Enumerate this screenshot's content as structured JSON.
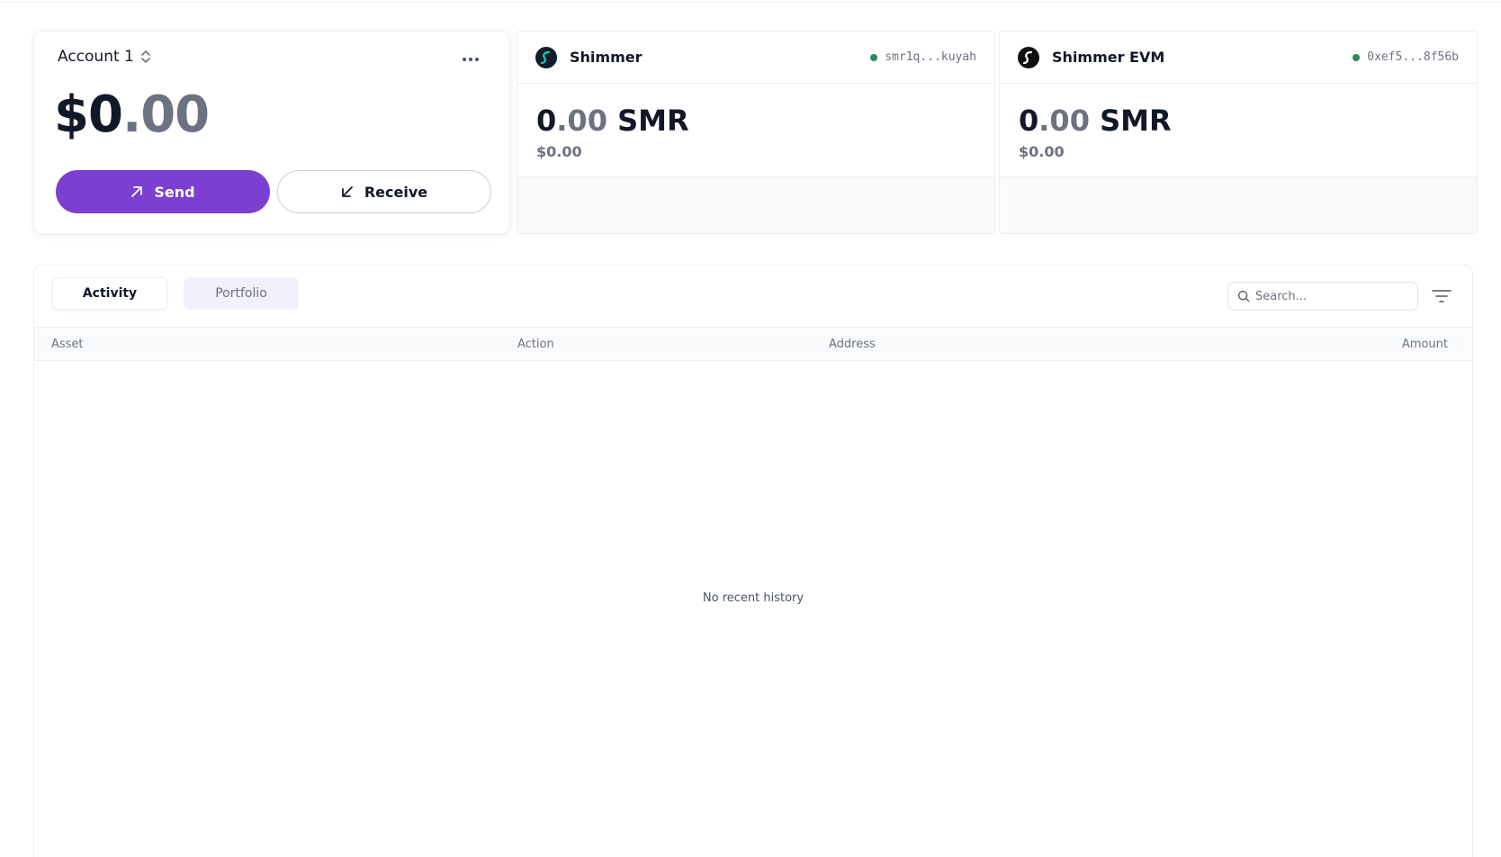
{
  "account": {
    "name": "Account 1",
    "balance_main": "$0",
    "balance_decimals": ".00",
    "send_label": "Send",
    "receive_label": "Receive"
  },
  "networks": [
    {
      "name": "Shimmer",
      "address": "smr1q...kuyah",
      "amount_int": "0",
      "amount_dec": ".00",
      "token": "SMR",
      "fiat": "$0.00"
    },
    {
      "name": "Shimmer EVM",
      "address": "0xef5...8f56b",
      "amount_int": "0",
      "amount_dec": ".00",
      "token": "SMR",
      "fiat": "$0.00"
    }
  ],
  "activity": {
    "tabs": [
      {
        "label": "Activity",
        "active": true
      },
      {
        "label": "Portfolio",
        "active": false
      }
    ],
    "search_placeholder": "Search...",
    "columns": [
      "Asset",
      "Action",
      "Address",
      "Amount"
    ],
    "empty_text": "No recent history"
  },
  "colors": {
    "accent": "#7b3fd1",
    "status_online": "#2e8b57"
  }
}
